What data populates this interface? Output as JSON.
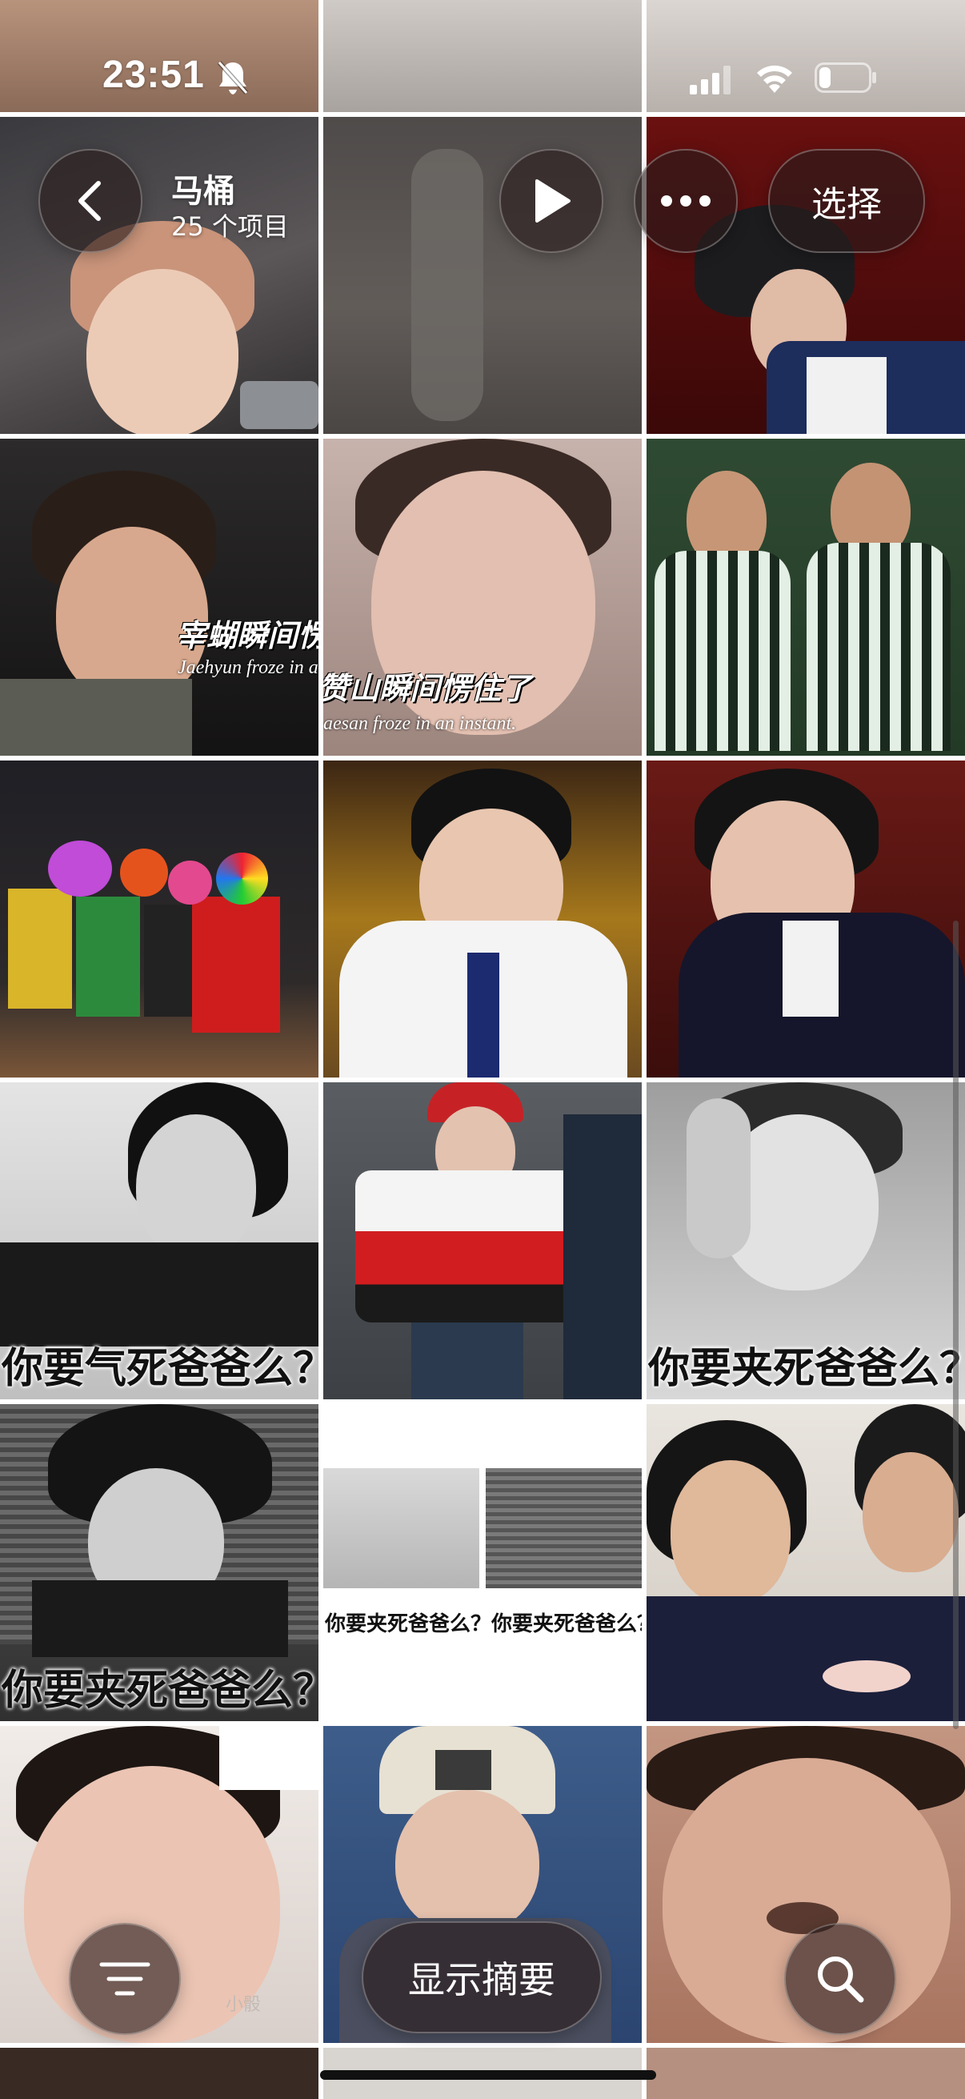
{
  "status_bar": {
    "time": "23:51",
    "icons": [
      "silent-bell-icon",
      "cellular-signal-icon",
      "wifi-icon",
      "battery-icon"
    ]
  },
  "header": {
    "title": "马桶",
    "item_count": "25 个项目",
    "select_label": "选择",
    "icons": [
      "chevron-left-icon",
      "play-icon",
      "ellipsis-icon"
    ]
  },
  "grid": {
    "tiles": [
      {
        "caption": ""
      },
      {
        "caption": ""
      },
      {
        "caption": ""
      },
      {
        "caption": "",
        "overlay_text": "宰蝴瞬间愣住",
        "overlay_sub": "Jaehyun froze in an ins"
      },
      {
        "caption": "",
        "overlay_text": "赞山瞬间愣住了",
        "overlay_sub": "aesan froze in an instant."
      },
      {
        "caption": ""
      },
      {
        "caption": ""
      },
      {
        "caption": ""
      },
      {
        "caption": ""
      },
      {
        "caption": "你要气死爸爸么？"
      },
      {
        "caption": ""
      },
      {
        "caption": "你要夹死爸爸么？"
      },
      {
        "caption": "你要夹死爸爸么？"
      },
      {
        "caption": "你要夹死爸爸么？你要夹死爸爸么？"
      },
      {
        "caption": ""
      },
      {
        "caption": "",
        "watermark": "小骰"
      },
      {
        "caption": ""
      },
      {
        "caption": ""
      }
    ]
  },
  "bottom_bar": {
    "summary_label": "显示摘要",
    "icons": [
      "filter-lines-icon",
      "search-icon"
    ]
  },
  "colors": {
    "glass_bg": "#2a1c1c",
    "text": "#ffffff",
    "caption": "#111111"
  }
}
